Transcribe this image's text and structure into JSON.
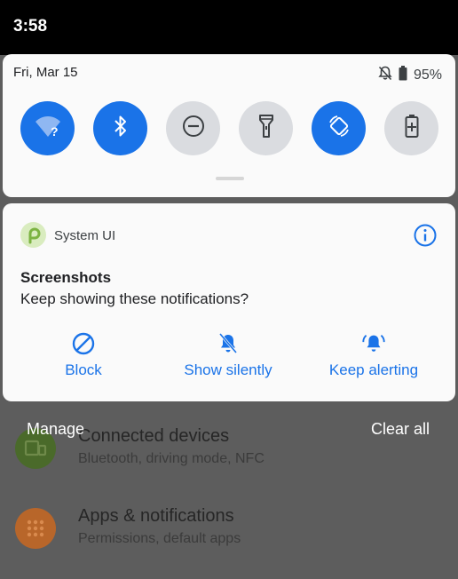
{
  "status_bar": {
    "time": "3:58"
  },
  "quick_settings": {
    "date": "Fri, Mar 15",
    "battery_percent": "95%",
    "tiles": [
      {
        "name": "wifi",
        "icon": "wifi-unknown-icon",
        "active": true
      },
      {
        "name": "bluetooth",
        "icon": "bluetooth-icon",
        "active": true
      },
      {
        "name": "do-not-disturb",
        "icon": "do-not-disturb-icon",
        "active": false
      },
      {
        "name": "flashlight",
        "icon": "flashlight-icon",
        "active": false
      },
      {
        "name": "auto-rotate",
        "icon": "auto-rotate-icon",
        "active": true
      },
      {
        "name": "battery-saver",
        "icon": "battery-saver-icon",
        "active": false
      }
    ]
  },
  "notification": {
    "app_name": "System UI",
    "title": "Screenshots",
    "body": "Keep showing these notifications?",
    "actions": {
      "block": "Block",
      "show_silently": "Show silently",
      "keep_alerting": "Keep alerting"
    }
  },
  "shade_footer": {
    "manage": "Manage",
    "clear_all": "Clear all"
  },
  "settings_behind": {
    "items": [
      {
        "title": "Connected devices",
        "subtitle": "Bluetooth, driving mode, NFC",
        "icon": "connected-devices-icon",
        "color": "#4a6a2a"
      },
      {
        "title": "Apps & notifications",
        "subtitle": "Permissions, default apps",
        "icon": "apps-grid-icon",
        "color": "#b8662a"
      }
    ]
  },
  "colors": {
    "accent": "#1a73e8",
    "tile_off": "#dadce0",
    "panel": "#fafafa"
  }
}
